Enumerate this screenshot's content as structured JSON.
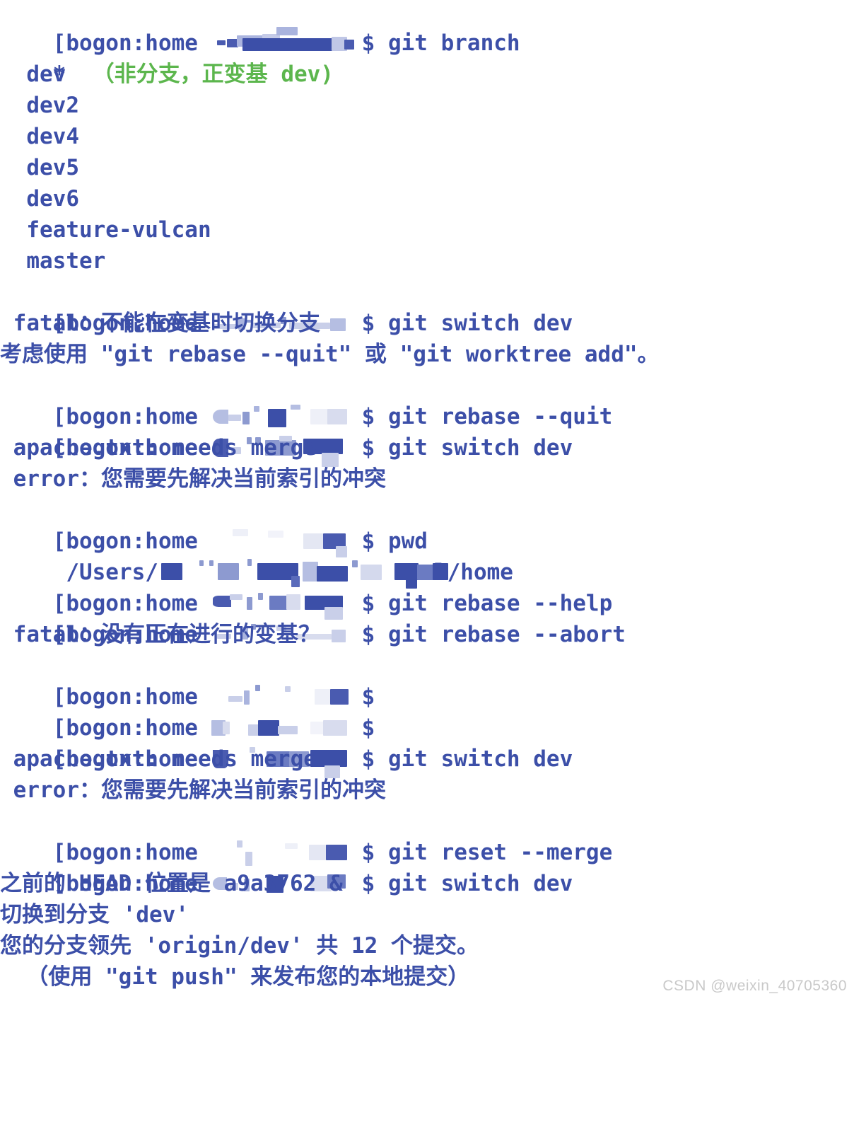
{
  "terminal": {
    "background_color": "#ffffff",
    "text_color": "#3c4fa8",
    "highlight_color": "#5cb64d",
    "prompt_prefix": "[bogon:home ",
    "prompt_suffix": "$ ",
    "lines": [
      {
        "id": "l1",
        "prompt": "[bogon:home ",
        "redacted": true,
        "tail": "$ git branch",
        "indent": 0
      },
      {
        "id": "l2",
        "text": "* （非分支，正变基 dev)",
        "star": "*",
        "green": "（非分支，正变基 dev)",
        "indent": 0
      },
      {
        "id": "l3",
        "text": "  dev",
        "indent": 2
      },
      {
        "id": "l4",
        "text": "  dev2",
        "indent": 2
      },
      {
        "id": "l5",
        "text": "  dev4",
        "indent": 2
      },
      {
        "id": "l6",
        "text": "  dev5",
        "indent": 2
      },
      {
        "id": "l7",
        "text": "  dev6",
        "indent": 2
      },
      {
        "id": "l8",
        "text": "  feature-vulcan",
        "indent": 2
      },
      {
        "id": "l9",
        "text": "  master",
        "indent": 2
      },
      {
        "id": "l10",
        "prompt": "[bogon:home ",
        "redacted": true,
        "tail": "$ git switch dev",
        "indent": 0
      },
      {
        "id": "l11",
        "text": " fatal：不能在变基时切换分支",
        "indent": 0
      },
      {
        "id": "l12",
        "text": "考虑使用 \"git rebase --quit\" 或 \"git worktree add\"。",
        "indent": 0
      },
      {
        "id": "l13",
        "prompt": "[bogon:home ",
        "redacted": true,
        "tail": "$ git rebase --quit",
        "indent": 0
      },
      {
        "id": "l14",
        "prompt": "[bogon:home ",
        "redacted": true,
        "tail": "$ git switch dev",
        "indent": 0
      },
      {
        "id": "l15",
        "text": " apache.txt: needs merge",
        "indent": 0
      },
      {
        "id": "l16",
        "text": " error：您需要先解决当前索引的冲突",
        "indent": 0
      },
      {
        "id": "l17",
        "prompt": "[bogon:home ",
        "redacted": true,
        "tail": "$ pwd",
        "indent": 0
      },
      {
        "id": "l18",
        "text": " /Users/",
        "redacted_path": true,
        "tail2": "l/home",
        "indent": 0
      },
      {
        "id": "l19",
        "prompt": "[bogon:home ",
        "redacted": true,
        "tail": "$ git rebase --help",
        "indent": 0
      },
      {
        "id": "l20",
        "prompt": "[bogon:home ",
        "redacted": true,
        "tail": "$ git rebase --abort",
        "indent": 0
      },
      {
        "id": "l21",
        "text": " fatal：没有正在进行的变基？",
        "indent": 0
      },
      {
        "id": "l22",
        "prompt": "[bogon:home ",
        "redacted": true,
        "tail": "$",
        "indent": 0
      },
      {
        "id": "l23",
        "prompt": "[bogon:home ",
        "redacted": true,
        "tail": "$",
        "indent": 0
      },
      {
        "id": "l24",
        "prompt": "[bogon:home ",
        "redacted": true,
        "tail": "$ git switch dev",
        "indent": 0
      },
      {
        "id": "l25",
        "text": " apache.txt: needs merge",
        "indent": 0
      },
      {
        "id": "l26",
        "text": " error：您需要先解决当前索引的冲突",
        "indent": 0
      },
      {
        "id": "l27",
        "prompt": "[bogon:home ",
        "redacted": true,
        "tail": "$ git reset --merge",
        "indent": 0
      },
      {
        "id": "l28",
        "prompt": "[bogon:home ",
        "redacted": true,
        "tail": "$ git switch dev",
        "indent": 0
      },
      {
        "id": "l29",
        "text": "之前的 HEAD 位置是 a9a3762 &",
        "indent": 0
      },
      {
        "id": "l30",
        "text": "切换到分支 'dev'",
        "indent": 0
      },
      {
        "id": "l31",
        "text": "您的分支领先 'origin/dev' 共 12 个提交。",
        "indent": 0
      },
      {
        "id": "l32",
        "text": "  （使用 \"git push\" 来发布您的本地提交）",
        "indent": 2
      }
    ]
  },
  "branches": {
    "current": "（非分支，正变基 dev)",
    "list": [
      "dev",
      "dev2",
      "dev4",
      "dev5",
      "dev6",
      "feature-vulcan",
      "master"
    ]
  },
  "commands": [
    "git branch",
    "git switch dev",
    "git rebase --quit",
    "git switch dev",
    "pwd",
    "git rebase --help",
    "git rebase --abort",
    "git switch dev",
    "git reset --merge",
    "git switch dev"
  ],
  "messages": {
    "fatal_rebase_switch": "fatal：不能在变基时切换分支",
    "consider_use": "考虑使用 \"git rebase --quit\" 或 \"git worktree add\"。",
    "needs_merge": "apache.txt: needs merge",
    "resolve_conflicts": "error：您需要先解决当前索引的冲突",
    "pwd_result_tail": "l/home",
    "pwd_result_head": "/Users/",
    "fatal_no_rebase": "fatal：没有正在进行的变基？",
    "head_was": "之前的 HEAD 位置是 a9a3762 &",
    "switched_branch": "切换到分支 'dev'",
    "ahead_by": "您的分支领先 'origin/dev' 共 12 个提交。",
    "push_hint": "（使用 \"git push\" 来发布您的本地提交）"
  },
  "watermark": {
    "text": "CSDN @weixin_40705360"
  }
}
